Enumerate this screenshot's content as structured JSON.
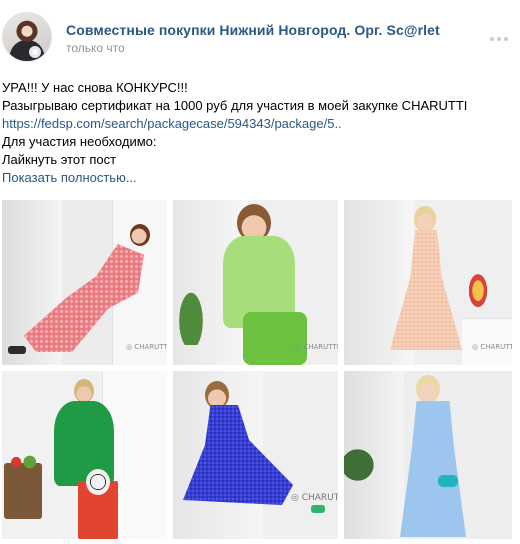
{
  "post": {
    "author": "Совместные покупки Нижний Новгород. Орг. Sc@rlet",
    "time": "только что",
    "lines": [
      "УРА!!! У нас снова КОНКУРС!!!",
      "Разыгрываю сертификат на 1000 руб для участия в моей закупке CHARUTTI"
    ],
    "link": "https://fedsp.com/search/packagecase/594343/package/5..",
    "lines_after": [
      "Для участия необходимо:",
      "Лайкнуть этот пост"
    ],
    "show_more": "Показать полностью...",
    "photo_brand": "CHARUTTI",
    "photos": [
      {
        "dress_color": "#e9787f",
        "name": "red-polka-dot-dress"
      },
      {
        "dress_color": "#a8dd7b",
        "name": "green-blouse-outfit"
      },
      {
        "dress_color": "#f2c0a3",
        "name": "peach-lace-dress"
      },
      {
        "dress_color": "#1f9b46",
        "name": "green-dress"
      },
      {
        "dress_color": "#2a2fc4",
        "name": "blue-lace-dress"
      },
      {
        "dress_color": "#9cc6ee",
        "name": "light-blue-dress"
      }
    ]
  }
}
